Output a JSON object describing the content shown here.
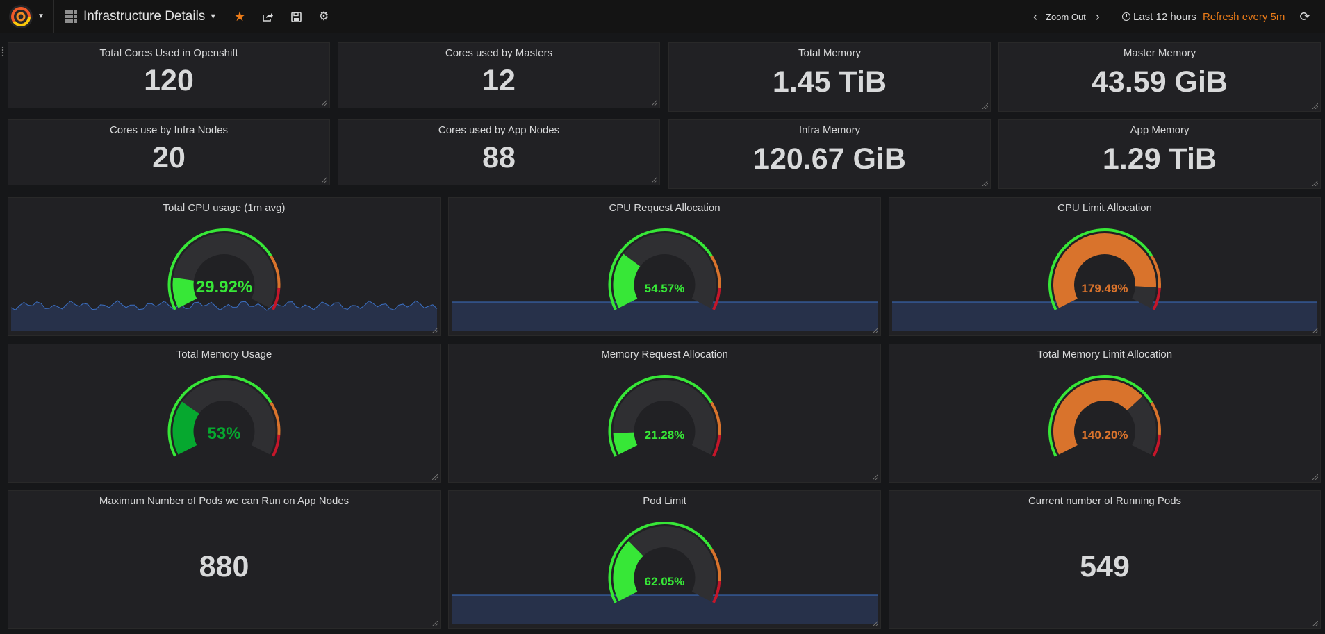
{
  "navbar": {
    "dashboard_title": "Infrastructure Details",
    "zoom_out_label": "Zoom Out",
    "time_range_label": "Last 12 hours",
    "refresh_label": "Refresh every 5m",
    "icons": [
      "grafana-logo-icon",
      "dashboard-grid-icon",
      "star-icon",
      "share-icon",
      "save-icon",
      "settings-gear-icon",
      "chevron-left-icon",
      "chevron-right-icon",
      "clock-icon",
      "refresh-icon"
    ],
    "accent_color": "#eb7b18"
  },
  "stats": {
    "total_cores": {
      "title": "Total Cores Used in Openshift",
      "value": "120"
    },
    "master_cores": {
      "title": "Cores used by Masters",
      "value": "12"
    },
    "total_memory": {
      "title": "Total Memory",
      "value": "1.45 TiB"
    },
    "master_memory": {
      "title": "Master Memory",
      "value": "43.59 GiB"
    },
    "infra_cores": {
      "title": "Cores use by Infra Nodes",
      "value": "20"
    },
    "app_cores": {
      "title": "Cores used by App Nodes",
      "value": "88"
    },
    "infra_memory": {
      "title": "Infra Memory",
      "value": "120.67 GiB"
    },
    "app_memory": {
      "title": "App Memory",
      "value": "1.29 TiB"
    },
    "max_pods": {
      "title": "Maximum Number of Pods we can Run on App Nodes",
      "value": "880"
    },
    "running_pods": {
      "title": "Current number of Running Pods",
      "value": "549"
    }
  },
  "gauges": {
    "cpu_usage": {
      "title": "Total CPU usage (1m avg)",
      "value_text": "29.92%",
      "percent": 29.92,
      "color": "#37e737",
      "sparkline": true
    },
    "cpu_request": {
      "title": "CPU Request Allocation",
      "value_text": "54.57%",
      "percent": 54.57,
      "color": "#37e737",
      "sparkline": true
    },
    "cpu_limit": {
      "title": "CPU Limit Allocation",
      "value_text": "179.49%",
      "percent": 179.49,
      "color": "#d9732c",
      "sparkline": true
    },
    "mem_usage": {
      "title": "Total Memory Usage",
      "value_text": "53%",
      "percent": 53,
      "color": "#06a82f",
      "sparkline": false
    },
    "mem_request": {
      "title": "Memory Request Allocation",
      "value_text": "21.28%",
      "percent": 21.28,
      "color": "#37e737",
      "sparkline": false
    },
    "mem_limit": {
      "title": "Total Memory Limit Allocation",
      "value_text": "140.20%",
      "percent": 140.2,
      "color": "#d9732c",
      "sparkline": false
    },
    "pod_limit": {
      "title": "Pod Limit",
      "value_text": "62.05%",
      "percent": 62.05,
      "color": "#37e737",
      "sparkline": true
    }
  },
  "colors": {
    "ok": "#37e737",
    "warn": "#d9732c",
    "crit": "#c4162a",
    "sparkline_fill": "#27314a",
    "sparkline_line": "#3b6fc2"
  }
}
